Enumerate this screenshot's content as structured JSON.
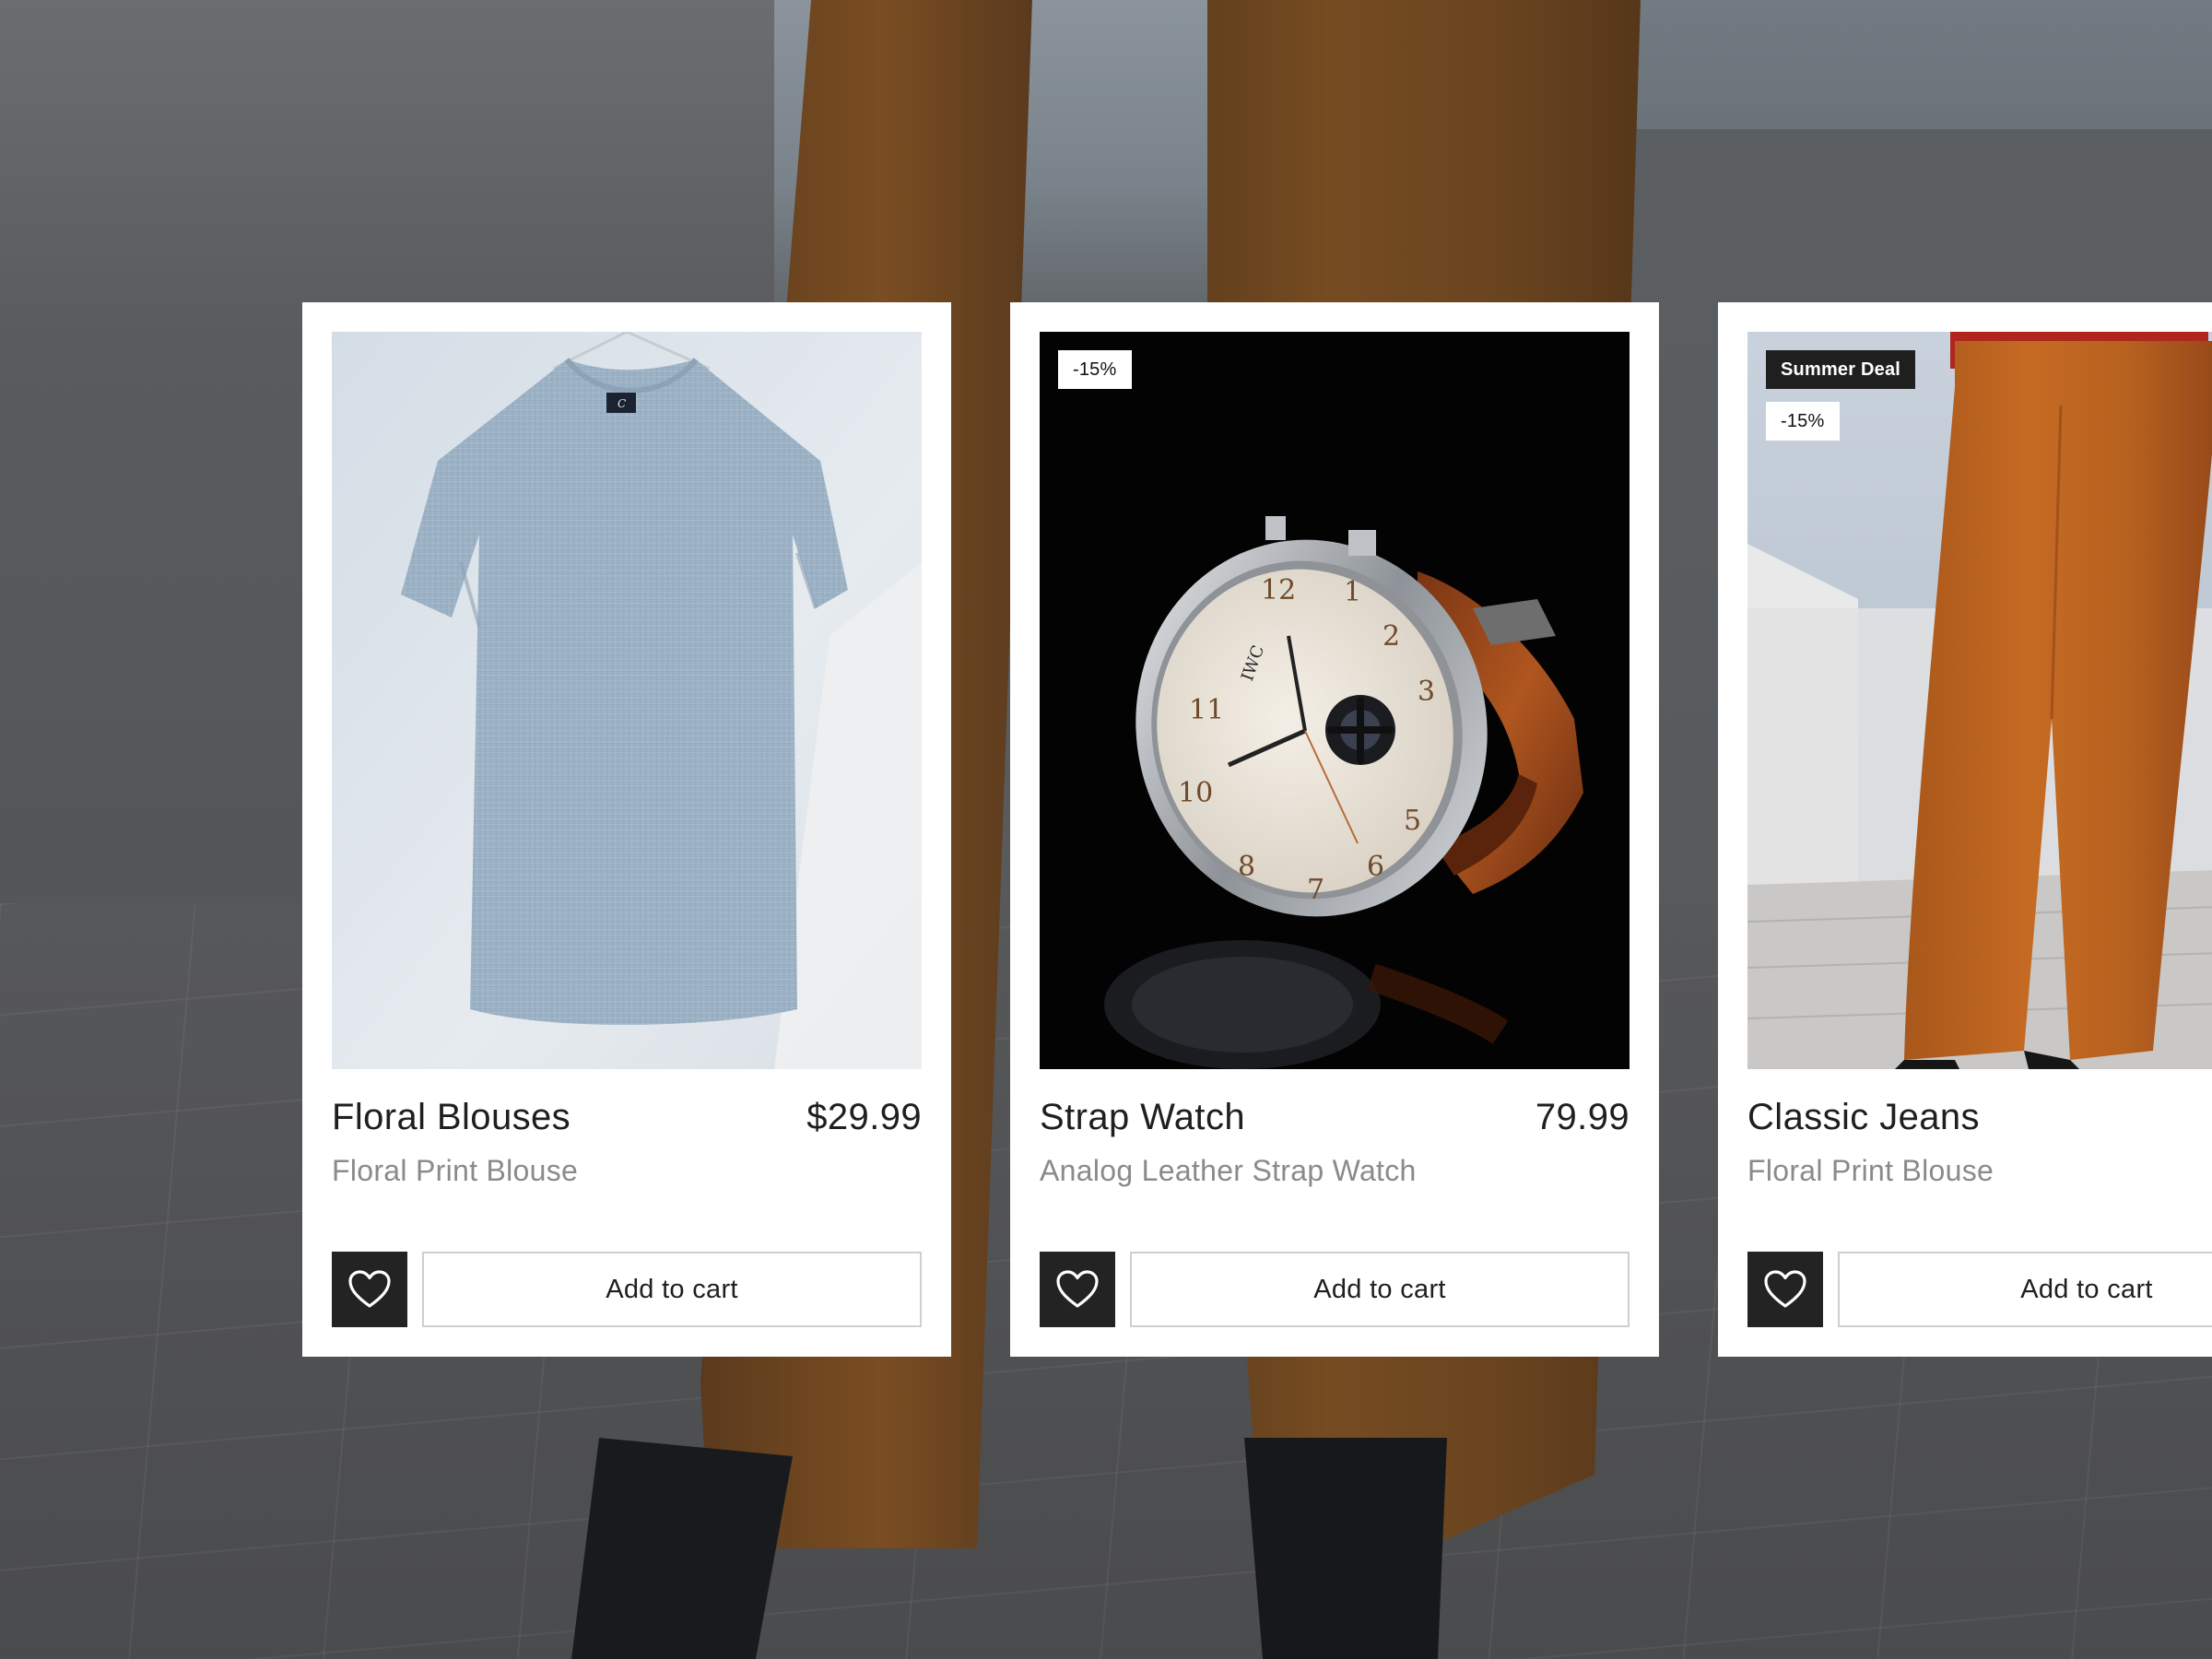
{
  "background": {
    "description_icon": "model-legs-rooftop-background"
  },
  "products": [
    {
      "title": "Floral Blouses",
      "price": "$29.99",
      "subtitle": "Floral Print Blouse",
      "image_icon": "tshirt-image",
      "badges": [],
      "add_to_cart_label": "Add to cart",
      "wishlist_icon": "heart-icon"
    },
    {
      "title": "Strap Watch",
      "price": "79.99",
      "subtitle": "Analog Leather Strap Watch",
      "image_icon": "watch-image",
      "badges": [
        "-15%"
      ],
      "add_to_cart_label": "Add to cart",
      "wishlist_icon": "heart-icon"
    },
    {
      "title": "Classic Jeans",
      "price": "",
      "subtitle": "Floral Print Blouse",
      "image_icon": "trousers-image",
      "badges": [
        "Summer Deal",
        "-15%"
      ],
      "add_to_cart_label": "Add to cart",
      "wishlist_icon": "heart-icon"
    }
  ],
  "colors": {
    "card_bg": "#ffffff",
    "wishlist_bg": "#232323",
    "title_text": "#1f1f1f",
    "subtitle_text": "#8a8a8a",
    "button_border": "#cfcfcf"
  }
}
